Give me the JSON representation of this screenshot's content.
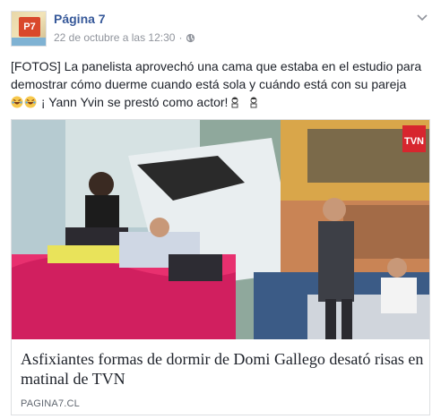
{
  "post": {
    "avatar_label": "P7",
    "page_name": "Página 7",
    "timestamp": "22 de octubre a las 12:30",
    "privacy_icon": "globe-icon",
    "menu_icon": "chevron-down-icon",
    "text": {
      "line1": "[FOTOS] La panelista aprovechó una cama que estaba en el estudio para",
      "line2": "demostrar cómo duerme cuando está sola y cuándo está con su pareja",
      "line3": "¡ Yann Yvin se prestó como actor!",
      "emoji_laugh": "laughing-emoji",
      "emoji_couple": "couple-emoji"
    }
  },
  "link_card": {
    "image_badge": "TVN",
    "title": "Asfixiantes formas de dormir de Domi Gallego desató risas en matinal de TVN",
    "domain": "PAGINA7.CL"
  },
  "colors": {
    "page_name": "#365899",
    "meta": "#90949c",
    "tvn_red": "#d7262e",
    "bed_pink": "#e8306f"
  }
}
